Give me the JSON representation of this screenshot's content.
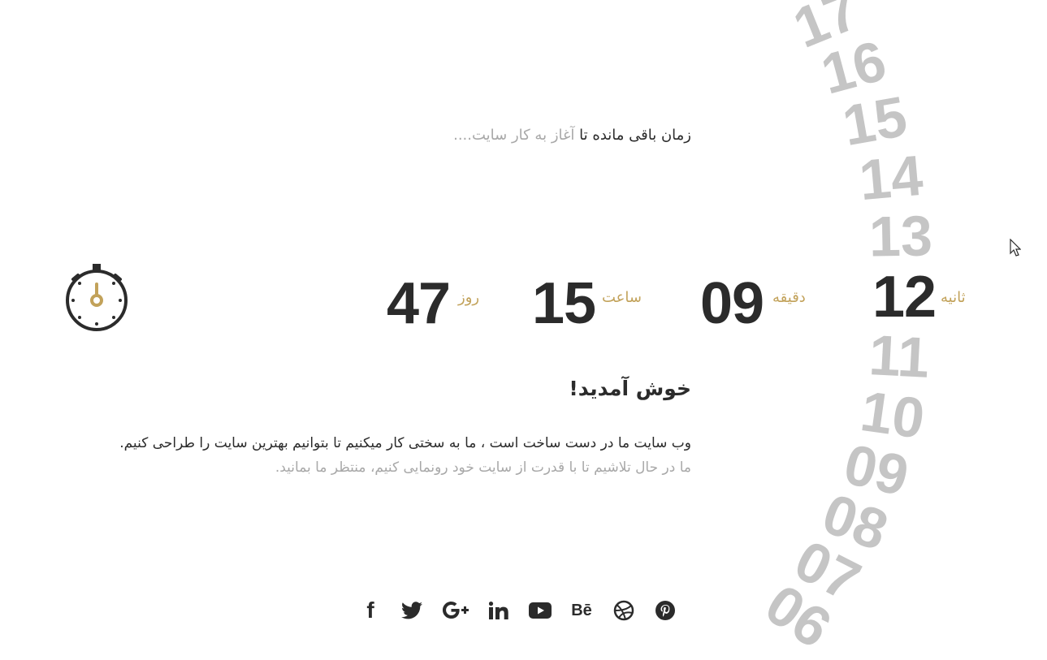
{
  "subtitle": {
    "part_dark_1": "زمان باقی مانده",
    "part_dark_2": "تا",
    "part_light": "آغاز به کار سایت...."
  },
  "countdown": {
    "seconds_label": "ثانیه",
    "seconds_value": "12",
    "minutes_label": "دقیقه",
    "minutes_value": "09",
    "hours_label": "ساعت",
    "hours_value": "15",
    "days_label": "روز",
    "days_value": "47"
  },
  "rolling_numbers": [
    "17",
    "16",
    "15",
    "14",
    "13",
    "11",
    "10",
    "09",
    "08",
    "07",
    "06"
  ],
  "welcome": {
    "title": "خوش آمدید!",
    "line1": "وب سایت ما در دست ساخت است ، ما به سختی کار میکنیم تا بتوانیم بهترین سایت را طراحی کنیم.",
    "line2": "ما در حال تلاشیم تا با قدرت از سایت خود رونمایی کنیم، منتظر ما بمانید."
  },
  "social": {
    "facebook": "f",
    "behance": "Bē"
  },
  "colors": {
    "accent": "#c2a25a",
    "text": "#2b2b2b",
    "muted": "#a8a8a8",
    "rolling": "#c5c5c5"
  },
  "icons": [
    "stopwatch-icon",
    "facebook-icon",
    "twitter-icon",
    "google-plus-icon",
    "linkedin-icon",
    "youtube-icon",
    "behance-icon",
    "dribbble-icon",
    "pinterest-icon",
    "cursor-icon"
  ]
}
